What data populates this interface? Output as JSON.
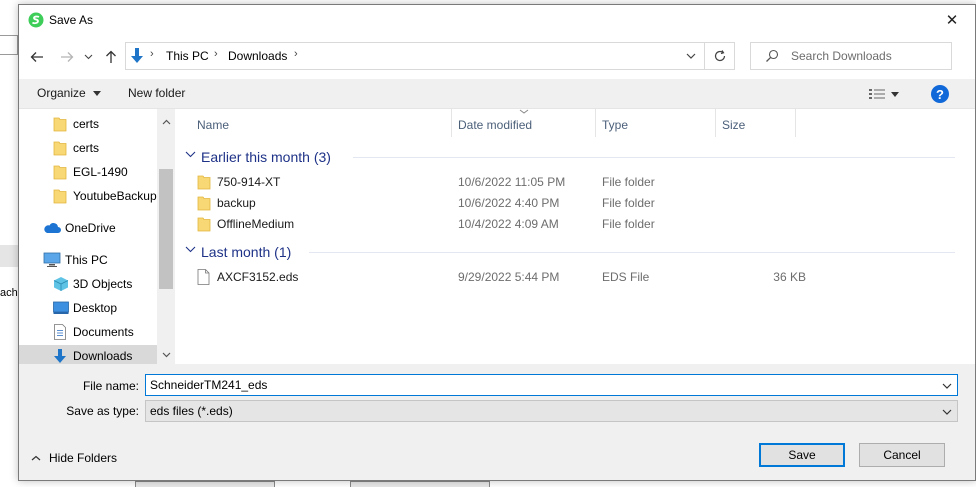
{
  "dialog": {
    "title": "Save As",
    "close_symbol": "✕"
  },
  "background": {
    "cut_text": "achi"
  },
  "nav": {
    "address": [
      "This PC",
      "Downloads"
    ],
    "search_placeholder": "Search Downloads"
  },
  "toolbar": {
    "organize": "Organize",
    "new_folder": "New folder",
    "help": "?"
  },
  "sidebar": {
    "items": [
      {
        "label": "certs",
        "icon": "folder-icon"
      },
      {
        "label": "certs",
        "icon": "folder-icon"
      },
      {
        "label": "EGL-1490",
        "icon": "folder-icon"
      },
      {
        "label": "YoutubeBackup",
        "icon": "folder-icon"
      },
      {
        "label": "OneDrive",
        "icon": "cloud-icon"
      },
      {
        "label": "This PC",
        "icon": "computer-icon"
      },
      {
        "label": "3D Objects",
        "icon": "cube-icon"
      },
      {
        "label": "Desktop",
        "icon": "desktop-icon"
      },
      {
        "label": "Documents",
        "icon": "document-icon"
      },
      {
        "label": "Downloads",
        "icon": "download-icon",
        "selected": true
      }
    ]
  },
  "columns": {
    "name": "Name",
    "date": "Date modified",
    "type": "Type",
    "size": "Size"
  },
  "groups": [
    {
      "title": "Earlier this month (3)",
      "rows": [
        {
          "name": "750-914-XT",
          "date": "10/6/2022 11:05 PM",
          "type": "File folder",
          "size": "",
          "icon": "folder-icon"
        },
        {
          "name": "backup",
          "date": "10/6/2022 4:40 PM",
          "type": "File folder",
          "size": "",
          "icon": "folder-icon"
        },
        {
          "name": "OfflineMedium",
          "date": "10/4/2022 4:09 AM",
          "type": "File folder",
          "size": "",
          "icon": "folder-icon"
        }
      ]
    },
    {
      "title": "Last month (1)",
      "rows": [
        {
          "name": "AXCF3152.eds",
          "date": "9/29/2022 5:44 PM",
          "type": "EDS File",
          "size": "36 KB",
          "icon": "file-icon"
        }
      ]
    }
  ],
  "form": {
    "filename_label": "File name:",
    "filename_value": "SchneiderTM241_eds",
    "savetype_label": "Save as type:",
    "savetype_value": "eds files (*.eds)"
  },
  "footer": {
    "hide_folders": "Hide Folders",
    "save": "Save",
    "cancel": "Cancel"
  },
  "colors": {
    "accent": "#0078d7",
    "group_title": "#1e3287",
    "folder": "#f8d775",
    "help_blue": "#1168d8"
  }
}
